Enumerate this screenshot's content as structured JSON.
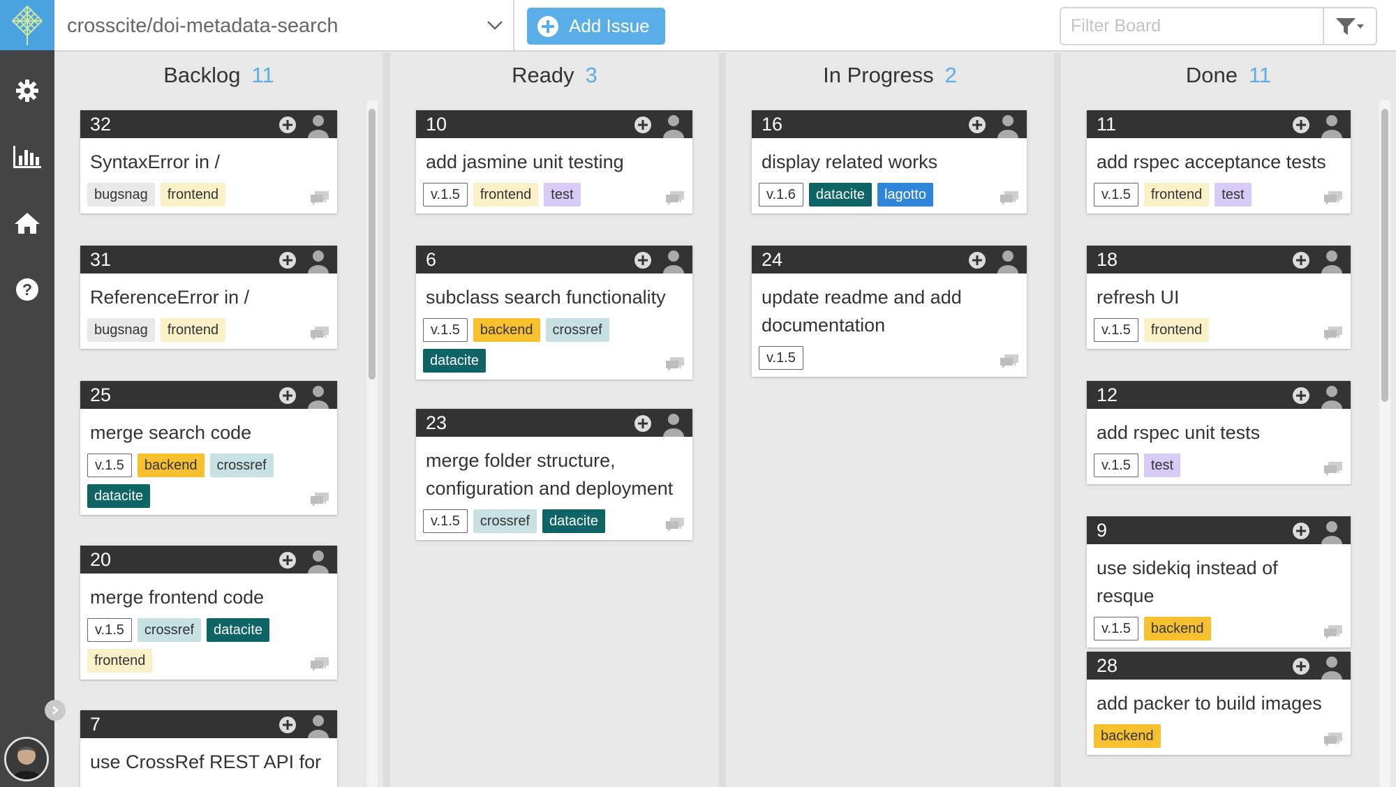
{
  "topbar": {
    "repo": "crosscite/doi-metadata-search",
    "add_issue_label": "Add Issue",
    "filter_placeholder": "Filter Board"
  },
  "sidebar": {
    "items": [
      {
        "icon": "gear-icon"
      },
      {
        "icon": "bar-chart-icon"
      },
      {
        "icon": "home-icon"
      },
      {
        "icon": "help-icon"
      }
    ]
  },
  "colors": {
    "accent": "#5aaee8",
    "sidebar": "#444444",
    "card_header": "#333333",
    "frontend": "#fbf1c8",
    "backend": "#f6c02e",
    "test": "#d8cbf5",
    "crossref": "#c8e2e4",
    "datacite": "#0f6466",
    "lagotto": "#2f86d8",
    "bugsnag": "#e8e8e8"
  },
  "columns": [
    {
      "title": "Backlog",
      "count": "11",
      "cards": [
        {
          "number": "32",
          "title": "SyntaxError in /",
          "labels": [
            {
              "text": "bugsnag",
              "type": "bugsnag"
            },
            {
              "text": "frontend",
              "type": "frontend"
            }
          ]
        },
        {
          "number": "31",
          "title": "ReferenceError in /",
          "labels": [
            {
              "text": "bugsnag",
              "type": "bugsnag"
            },
            {
              "text": "frontend",
              "type": "frontend"
            }
          ]
        },
        {
          "number": "25",
          "title": "merge search code",
          "labels": [
            {
              "text": "v.1.5",
              "type": "version"
            },
            {
              "text": "backend",
              "type": "backend"
            },
            {
              "text": "crossref",
              "type": "crossref"
            },
            {
              "text": "datacite",
              "type": "datacite"
            }
          ]
        },
        {
          "number": "20",
          "title": "merge frontend code",
          "labels": [
            {
              "text": "v.1.5",
              "type": "version"
            },
            {
              "text": "crossref",
              "type": "crossref"
            },
            {
              "text": "datacite",
              "type": "datacite"
            },
            {
              "text": "frontend",
              "type": "frontend"
            }
          ]
        },
        {
          "number": "7",
          "title": "use CrossRef REST API for",
          "labels": []
        }
      ]
    },
    {
      "title": "Ready",
      "count": "3",
      "cards": [
        {
          "number": "10",
          "title": "add jasmine unit testing",
          "labels": [
            {
              "text": "v.1.5",
              "type": "version"
            },
            {
              "text": "frontend",
              "type": "frontend"
            },
            {
              "text": "test",
              "type": "test"
            }
          ]
        },
        {
          "number": "6",
          "title": "subclass search functionality",
          "labels": [
            {
              "text": "v.1.5",
              "type": "version"
            },
            {
              "text": "backend",
              "type": "backend"
            },
            {
              "text": "crossref",
              "type": "crossref"
            },
            {
              "text": "datacite",
              "type": "datacite"
            }
          ]
        },
        {
          "number": "23",
          "title": "merge folder structure, configuration and deployment",
          "labels": [
            {
              "text": "v.1.5",
              "type": "version"
            },
            {
              "text": "crossref",
              "type": "crossref"
            },
            {
              "text": "datacite",
              "type": "datacite"
            }
          ]
        }
      ]
    },
    {
      "title": "In Progress",
      "count": "2",
      "cards": [
        {
          "number": "16",
          "title": "display related works",
          "labels": [
            {
              "text": "v.1.6",
              "type": "version"
            },
            {
              "text": "datacite",
              "type": "datacite"
            },
            {
              "text": "lagotto",
              "type": "lagotto"
            }
          ]
        },
        {
          "number": "24",
          "title": "update readme and add documentation",
          "labels": [
            {
              "text": "v.1.5",
              "type": "version"
            }
          ]
        }
      ]
    },
    {
      "title": "Done",
      "count": "11",
      "cards": [
        {
          "number": "11",
          "title": "add rspec acceptance tests",
          "labels": [
            {
              "text": "v.1.5",
              "type": "version"
            },
            {
              "text": "frontend",
              "type": "frontend"
            },
            {
              "text": "test",
              "type": "test"
            }
          ]
        },
        {
          "number": "18",
          "title": "refresh UI",
          "labels": [
            {
              "text": "v.1.5",
              "type": "version"
            },
            {
              "text": "frontend",
              "type": "frontend"
            }
          ]
        },
        {
          "number": "12",
          "title": "add rspec unit tests",
          "labels": [
            {
              "text": "v.1.5",
              "type": "version"
            },
            {
              "text": "test",
              "type": "test"
            }
          ]
        },
        {
          "number": "9",
          "title": "use sidekiq instead of resque",
          "labels": [
            {
              "text": "v.1.5",
              "type": "version"
            },
            {
              "text": "backend",
              "type": "backend"
            }
          ]
        },
        {
          "number": "28",
          "title": "add packer to build images",
          "labels": [
            {
              "text": "backend",
              "type": "backend"
            }
          ]
        }
      ]
    }
  ]
}
